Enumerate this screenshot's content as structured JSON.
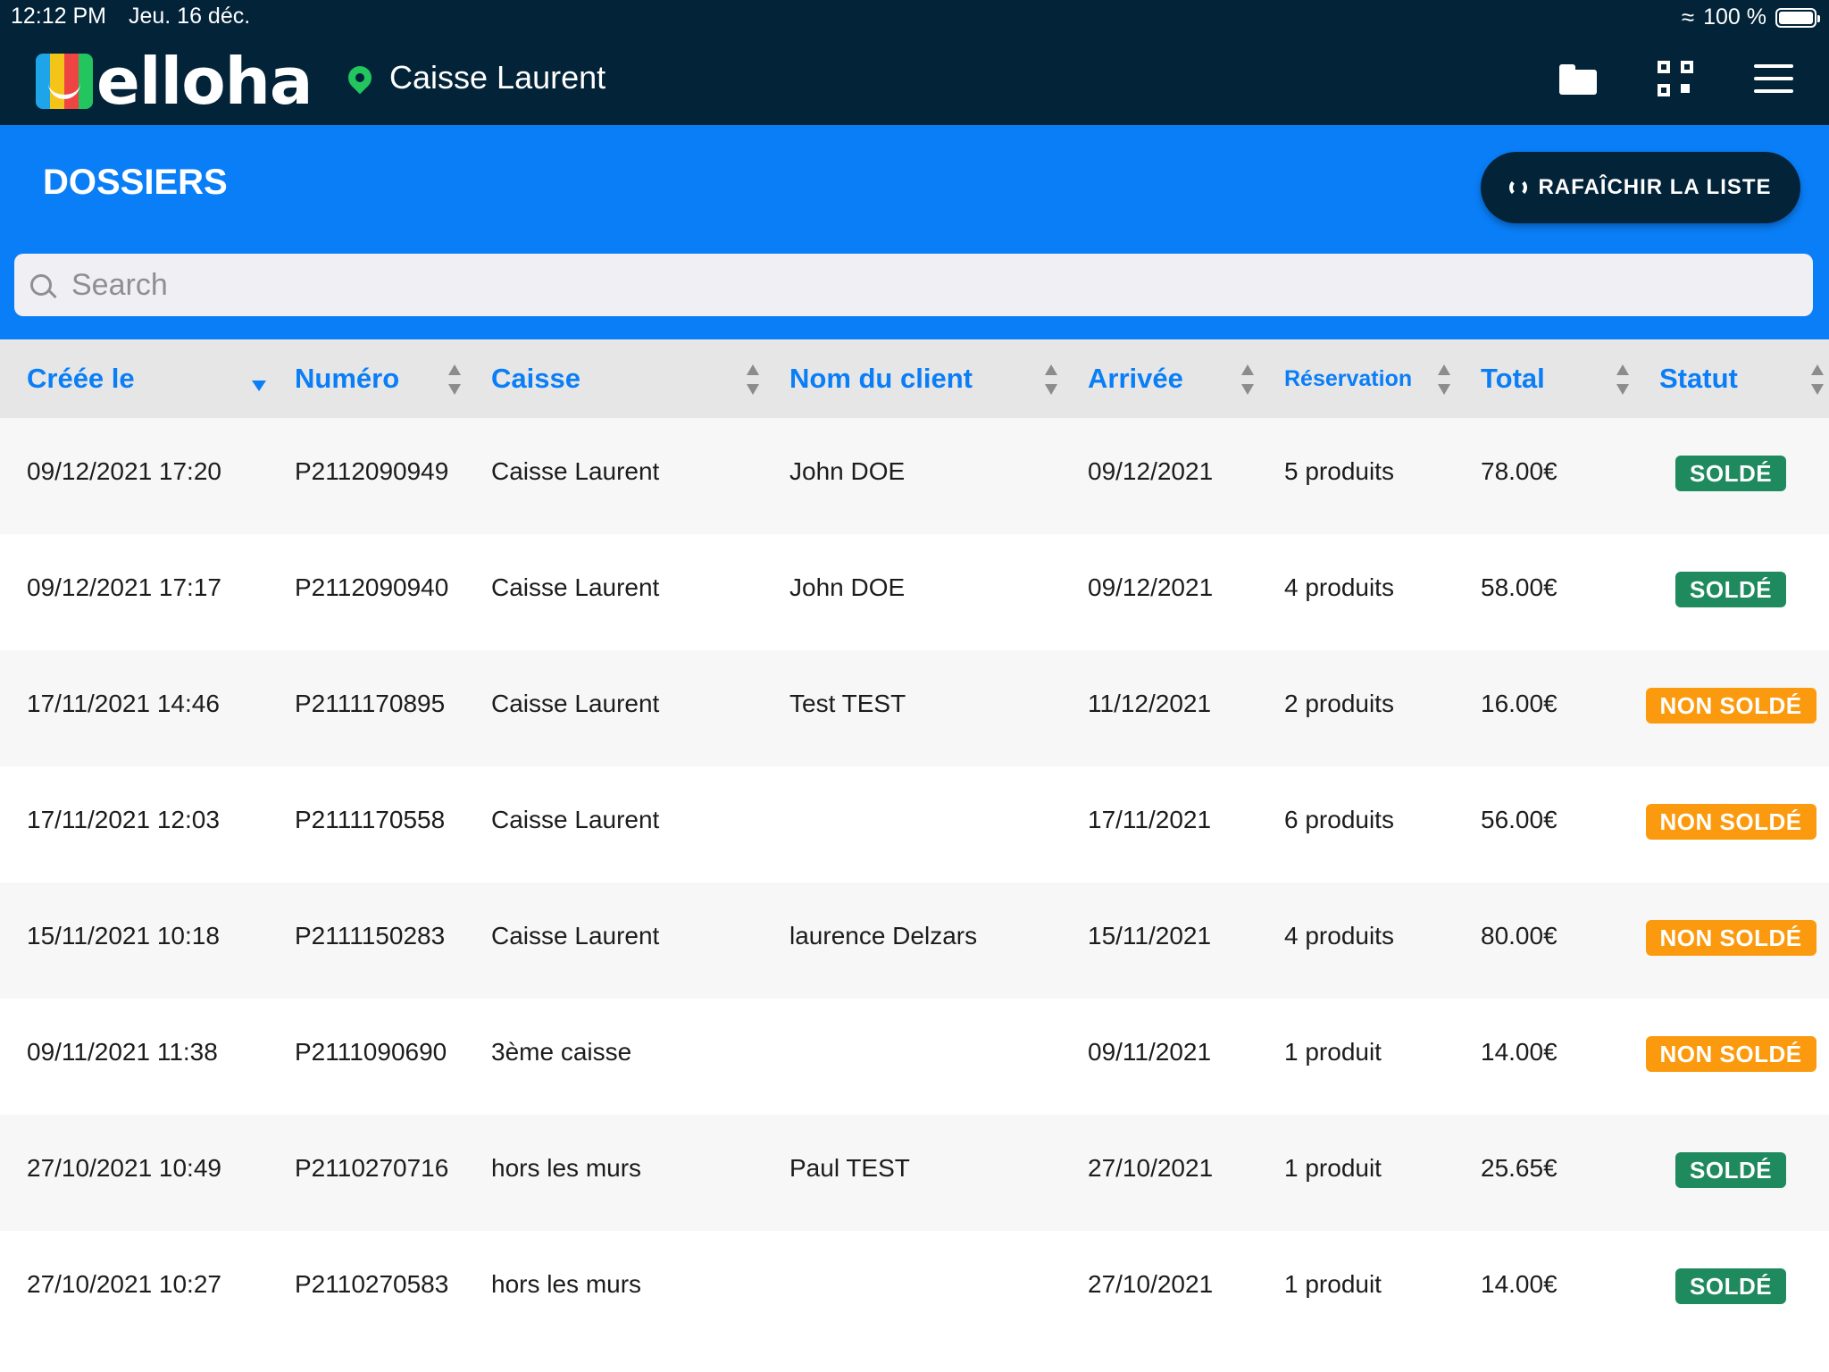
{
  "status_bar": {
    "time": "12:12 PM",
    "date": "Jeu. 16 déc.",
    "battery": "100 %"
  },
  "header": {
    "logo_text": "elloha",
    "location": "Caisse Laurent",
    "icons": [
      "folder-icon",
      "qr-code-icon",
      "hamburger-menu-icon"
    ]
  },
  "page": {
    "title": "DOSSIERS",
    "refresh_label": "RAFAÎCHIR LA LISTE",
    "search_placeholder": "Search"
  },
  "colors": {
    "header_bg": "#022338",
    "accent_blue": "#0a7ef7",
    "solde": "#1e8a5e",
    "non_solde": "#fb9a0e"
  },
  "table": {
    "columns": [
      "Créée le",
      "Numéro",
      "Caisse",
      "Nom du client",
      "Arrivée",
      "Réservation",
      "Total",
      "Statut"
    ],
    "rows": [
      {
        "created": "09/12/2021 17:20",
        "number": "P2112090949",
        "register": "Caisse Laurent",
        "client": "John DOE",
        "arrival": "09/12/2021",
        "booking": "5 produits",
        "total": "78.00€",
        "status": "SOLDÉ",
        "paid": true
      },
      {
        "created": "09/12/2021 17:17",
        "number": "P2112090940",
        "register": "Caisse Laurent",
        "client": "John DOE",
        "arrival": "09/12/2021",
        "booking": "4 produits",
        "total": "58.00€",
        "status": "SOLDÉ",
        "paid": true
      },
      {
        "created": "17/11/2021 14:46",
        "number": "P2111170895",
        "register": "Caisse Laurent",
        "client": "Test TEST",
        "arrival": "11/12/2021",
        "booking": "2 produits",
        "total": "16.00€",
        "status": "NON SOLDÉ",
        "paid": false
      },
      {
        "created": "17/11/2021 12:03",
        "number": "P2111170558",
        "register": "Caisse Laurent",
        "client": "",
        "arrival": "17/11/2021",
        "booking": "6 produits",
        "total": "56.00€",
        "status": "NON SOLDÉ",
        "paid": false
      },
      {
        "created": "15/11/2021 10:18",
        "number": "P2111150283",
        "register": "Caisse Laurent",
        "client": "laurence Delzars",
        "arrival": "15/11/2021",
        "booking": "4 produits",
        "total": "80.00€",
        "status": "NON SOLDÉ",
        "paid": false
      },
      {
        "created": "09/11/2021 11:38",
        "number": "P2111090690",
        "register": "3ème caisse",
        "client": "",
        "arrival": "09/11/2021",
        "booking": "1 produit",
        "total": "14.00€",
        "status": "NON SOLDÉ",
        "paid": false
      },
      {
        "created": "27/10/2021 10:49",
        "number": "P2110270716",
        "register": "hors les murs",
        "client": "Paul TEST",
        "arrival": "27/10/2021",
        "booking": "1 produit",
        "total": "25.65€",
        "status": "SOLDÉ",
        "paid": true
      },
      {
        "created": "27/10/2021 10:27",
        "number": "P2110270583",
        "register": "hors les murs",
        "client": "",
        "arrival": "27/10/2021",
        "booking": "1 produit",
        "total": "14.00€",
        "status": "SOLDÉ",
        "paid": true
      }
    ]
  }
}
